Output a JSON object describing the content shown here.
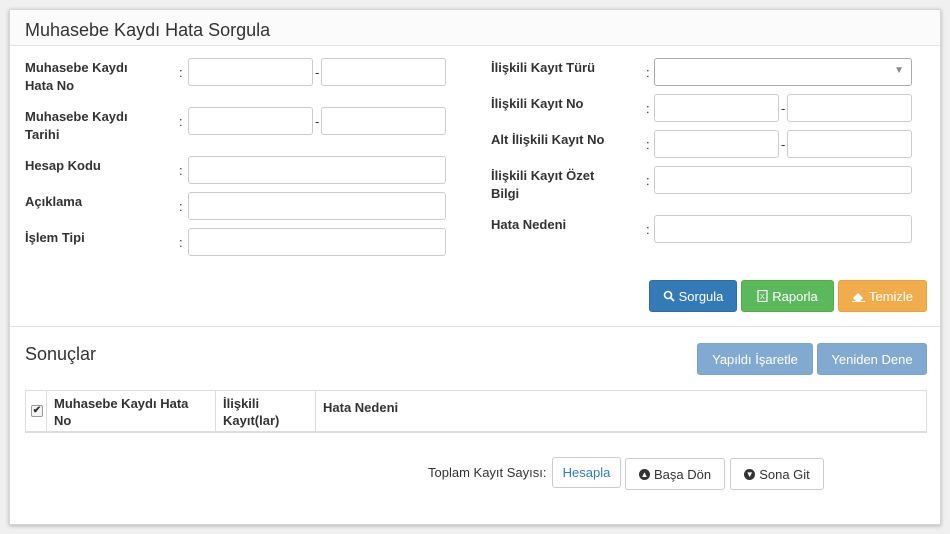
{
  "header": {
    "title": "Muhasebe Kaydı Hata Sorgula"
  },
  "form_left": {
    "hata_no_label": "Muhasebe Kaydı Hata No",
    "tarih_label": "Muhasebe Kaydı Tarihi",
    "hesap_kodu_label": "Hesap Kodu",
    "aciklama_label": "Açıklama",
    "islem_tipi_label": "İşlem Tipi"
  },
  "form_right": {
    "kayit_turu_label": "İlişkili Kayıt Türü",
    "kayit_no_label": "İlişkili Kayıt No",
    "alt_kayit_no_label": "Alt İlişkili Kayıt No",
    "ozet_bilgi_label": "İlişkili Kayıt Özet Bilgi",
    "hata_nedeni_label": "Hata Nedeni"
  },
  "separators": {
    "colon": ":",
    "dash": "-"
  },
  "actions": {
    "sorgula": "Sorgula",
    "raporla": "Raporla",
    "temizle": "Temizle"
  },
  "results": {
    "title": "Sonuçlar",
    "mark_done": "Yapıldı İşaretle",
    "retry": "Yeniden Dene",
    "columns": [
      "Muhasebe Kaydı Hata No",
      "İlişkili Kayıt(lar)",
      "Hata Nedeni"
    ]
  },
  "footer": {
    "total_label": "Toplam Kayıt Sayısı:",
    "calc": "Hesapla",
    "first": "Başa Dön",
    "last": "Sona Git"
  },
  "colors": {
    "primary": "#337ab7",
    "success": "#5cb85c",
    "warning": "#f0ad4e",
    "disabled_primary": "#82a9cf"
  },
  "icons": {
    "search": "search-icon",
    "report": "excel-file-icon",
    "clear": "eraser-icon",
    "first": "circle-arrow-up-icon",
    "last": "circle-arrow-down-icon"
  }
}
